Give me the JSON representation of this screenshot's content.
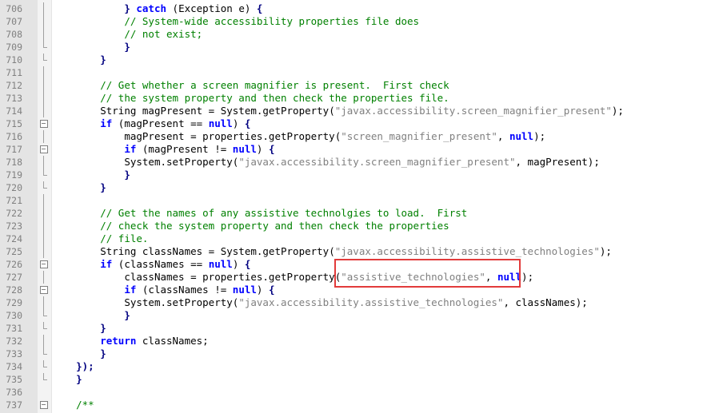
{
  "annotation": {
    "label": "red-highlight-box"
  },
  "lines": [
    {
      "n": "706",
      "fold": "vline",
      "indent": "            ",
      "tokens": [
        [
          "pn",
          "} "
        ],
        [
          "kw",
          "catch"
        ],
        [
          "txt",
          " (Exception e) "
        ],
        [
          "pn",
          "{"
        ]
      ]
    },
    {
      "n": "707",
      "fold": "vline",
      "indent": "            ",
      "tokens": [
        [
          "cmt",
          "// System-wide accessibility properties file does"
        ]
      ]
    },
    {
      "n": "708",
      "fold": "vline",
      "indent": "            ",
      "tokens": [
        [
          "cmt",
          "// not exist;"
        ]
      ]
    },
    {
      "n": "709",
      "fold": "end",
      "indent": "            ",
      "tokens": [
        [
          "pn",
          "}"
        ]
      ]
    },
    {
      "n": "710",
      "fold": "end",
      "indent": "        ",
      "tokens": [
        [
          "pn",
          "}"
        ]
      ]
    },
    {
      "n": "711",
      "fold": "vline",
      "indent": "",
      "tokens": []
    },
    {
      "n": "712",
      "fold": "vline",
      "indent": "        ",
      "tokens": [
        [
          "cmt",
          "// Get whether a screen magnifier is present.  First check"
        ]
      ]
    },
    {
      "n": "713",
      "fold": "vline",
      "indent": "        ",
      "tokens": [
        [
          "cmt",
          "// the system property and then check the properties file."
        ]
      ]
    },
    {
      "n": "714",
      "fold": "vline",
      "indent": "        ",
      "tokens": [
        [
          "txt",
          "String magPresent = System.getProperty("
        ],
        [
          "str",
          "\"javax.accessibility.screen_magnifier_present\""
        ],
        [
          "txt",
          ");"
        ]
      ]
    },
    {
      "n": "715",
      "fold": "box",
      "indent": "        ",
      "tokens": [
        [
          "kw",
          "if"
        ],
        [
          "txt",
          " (magPresent == "
        ],
        [
          "kw",
          "null"
        ],
        [
          "txt",
          ") "
        ],
        [
          "pn",
          "{"
        ]
      ]
    },
    {
      "n": "716",
      "fold": "vline",
      "indent": "            ",
      "tokens": [
        [
          "txt",
          "magPresent = properties.getProperty("
        ],
        [
          "str",
          "\"screen_magnifier_present\""
        ],
        [
          "txt",
          ", "
        ],
        [
          "kw",
          "null"
        ],
        [
          "txt",
          ");"
        ]
      ]
    },
    {
      "n": "717",
      "fold": "box",
      "indent": "            ",
      "tokens": [
        [
          "kw",
          "if"
        ],
        [
          "txt",
          " (magPresent != "
        ],
        [
          "kw",
          "null"
        ],
        [
          "txt",
          ") "
        ],
        [
          "pn",
          "{"
        ]
      ]
    },
    {
      "n": "718",
      "fold": "vline",
      "indent": "            ",
      "tokens": [
        [
          "txt",
          "System.setProperty("
        ],
        [
          "str",
          "\"javax.accessibility.screen_magnifier_present\""
        ],
        [
          "txt",
          ", magPresent);"
        ]
      ]
    },
    {
      "n": "719",
      "fold": "end",
      "indent": "            ",
      "tokens": [
        [
          "pn",
          "}"
        ]
      ]
    },
    {
      "n": "720",
      "fold": "end",
      "indent": "        ",
      "tokens": [
        [
          "pn",
          "}"
        ]
      ]
    },
    {
      "n": "721",
      "fold": "vline",
      "indent": "",
      "tokens": []
    },
    {
      "n": "722",
      "fold": "vline",
      "indent": "        ",
      "tokens": [
        [
          "cmt",
          "// Get the names of any assistive technolgies to load.  First"
        ]
      ]
    },
    {
      "n": "723",
      "fold": "vline",
      "indent": "        ",
      "tokens": [
        [
          "cmt",
          "// check the system property and then check the properties"
        ]
      ]
    },
    {
      "n": "724",
      "fold": "vline",
      "indent": "        ",
      "tokens": [
        [
          "cmt",
          "// file."
        ]
      ]
    },
    {
      "n": "725",
      "fold": "vline",
      "indent": "        ",
      "tokens": [
        [
          "txt",
          "String classNames = System.getProperty("
        ],
        [
          "str",
          "\"javax.accessibility.assistive_technologies\""
        ],
        [
          "txt",
          ");"
        ]
      ]
    },
    {
      "n": "726",
      "fold": "box",
      "indent": "        ",
      "tokens": [
        [
          "kw",
          "if"
        ],
        [
          "txt",
          " (classNames == "
        ],
        [
          "kw",
          "null"
        ],
        [
          "txt",
          ") "
        ],
        [
          "pn",
          "{"
        ]
      ]
    },
    {
      "n": "727",
      "fold": "vline",
      "indent": "            ",
      "tokens": [
        [
          "txt",
          "classNames = properties.getProperty("
        ],
        [
          "str",
          "\"assistive_technologies\""
        ],
        [
          "txt",
          ", "
        ],
        [
          "kw",
          "null"
        ],
        [
          "txt",
          ");"
        ]
      ]
    },
    {
      "n": "728",
      "fold": "box",
      "indent": "            ",
      "tokens": [
        [
          "kw",
          "if"
        ],
        [
          "txt",
          " (classNames != "
        ],
        [
          "kw",
          "null"
        ],
        [
          "txt",
          ") "
        ],
        [
          "pn",
          "{"
        ]
      ]
    },
    {
      "n": "729",
      "fold": "vline",
      "indent": "            ",
      "tokens": [
        [
          "txt",
          "System.setProperty("
        ],
        [
          "str",
          "\"javax.accessibility.assistive_technologies\""
        ],
        [
          "txt",
          ", classNames);"
        ]
      ]
    },
    {
      "n": "730",
      "fold": "end",
      "indent": "            ",
      "tokens": [
        [
          "pn",
          "}"
        ]
      ]
    },
    {
      "n": "731",
      "fold": "end",
      "indent": "        ",
      "tokens": [
        [
          "pn",
          "}"
        ]
      ]
    },
    {
      "n": "732",
      "fold": "vline",
      "indent": "        ",
      "tokens": [
        [
          "kw",
          "return"
        ],
        [
          "txt",
          " classNames;"
        ]
      ]
    },
    {
      "n": "733",
      "fold": "end",
      "indent": "        ",
      "tokens": [
        [
          "pn",
          "}"
        ]
      ]
    },
    {
      "n": "734",
      "fold": "end",
      "indent": "    ",
      "tokens": [
        [
          "pn",
          "});"
        ]
      ]
    },
    {
      "n": "735",
      "fold": "end",
      "indent": "    ",
      "tokens": [
        [
          "pn",
          "}"
        ]
      ]
    },
    {
      "n": "736",
      "fold": "none",
      "indent": "",
      "tokens": []
    },
    {
      "n": "737",
      "fold": "box",
      "indent": "    ",
      "tokens": [
        [
          "cmt",
          "/**"
        ]
      ]
    }
  ]
}
